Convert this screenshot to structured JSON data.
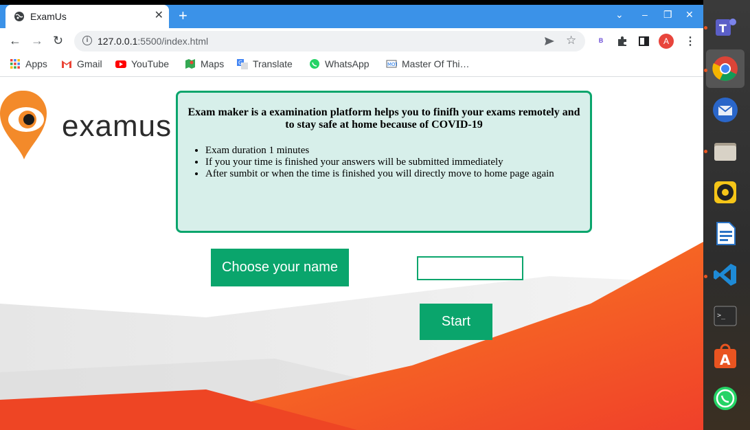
{
  "browser": {
    "tab_title": "ExamUs",
    "tab_close": "✕",
    "new_tab": "+",
    "url_host": "127.0.0.1",
    "url_path": ":5500/index.html",
    "profile_initial": "A",
    "extension_badge": "B",
    "window_controls": {
      "dropdown": "⌄",
      "minimize": "–",
      "restore": "❐",
      "close": "✕"
    }
  },
  "bookmarks": [
    {
      "label": "Apps",
      "icon": "apps-grid-icon"
    },
    {
      "label": "Gmail",
      "icon": "gmail-icon"
    },
    {
      "label": "YouTube",
      "icon": "youtube-icon"
    },
    {
      "label": "Maps",
      "icon": "maps-icon"
    },
    {
      "label": "Translate",
      "icon": "translate-icon"
    },
    {
      "label": "WhatsApp",
      "icon": "whatsapp-icon"
    },
    {
      "label": "Master Of Thi…",
      "icon": "site-icon"
    }
  ],
  "page": {
    "logo_text": "examus",
    "info": {
      "title": "Exam maker is a examination platform helps you to finifh your exams remotely and to stay safe at home because of COVID-19",
      "items": [
        "Exam duration 1 minutes",
        "If you your time is finished your answers will be submitted immediately",
        "After sumbit or when the time is finished you will directly move to home page again"
      ]
    },
    "choose_label": "Choose your name",
    "name_value": "",
    "start_label": "Start"
  },
  "colors": {
    "accent": "#0aa56c",
    "info_bg": "#d7efea",
    "tabstrip": "#3b92e8",
    "logo_orange": "#f38a2a"
  },
  "dock": [
    {
      "name": "teams-icon"
    },
    {
      "name": "chrome-icon"
    },
    {
      "name": "thunderbird-icon"
    },
    {
      "name": "files-icon"
    },
    {
      "name": "rhythmbox-icon"
    },
    {
      "name": "writer-icon"
    },
    {
      "name": "vscode-icon"
    },
    {
      "name": "terminal-icon"
    },
    {
      "name": "software-center-icon"
    },
    {
      "name": "whatsapp-dock-icon"
    }
  ]
}
